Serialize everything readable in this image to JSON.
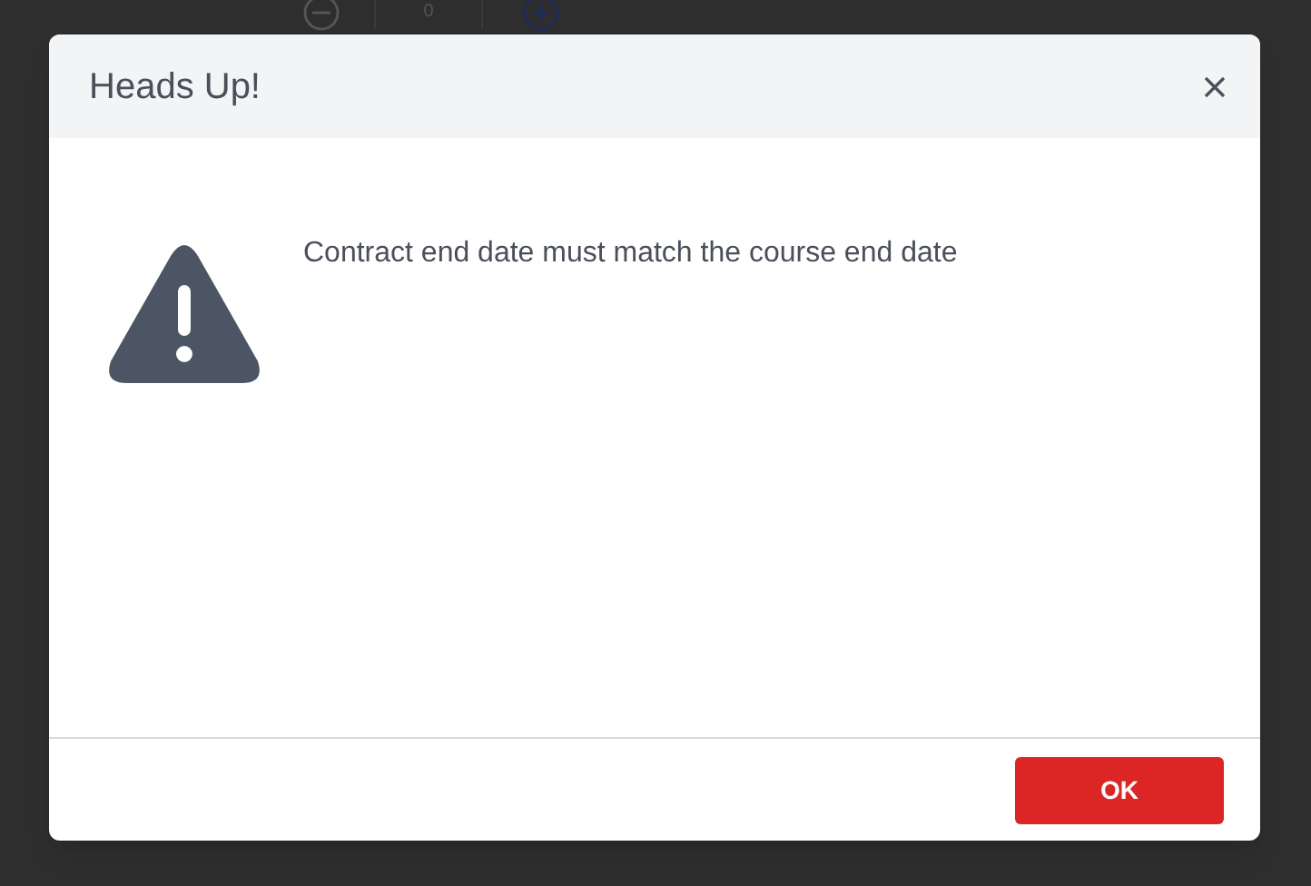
{
  "background": {
    "stepper_value": "0"
  },
  "dialog": {
    "title": "Heads Up!",
    "message": "Contract end date must match the course end date",
    "buttons": [
      "OK"
    ]
  }
}
